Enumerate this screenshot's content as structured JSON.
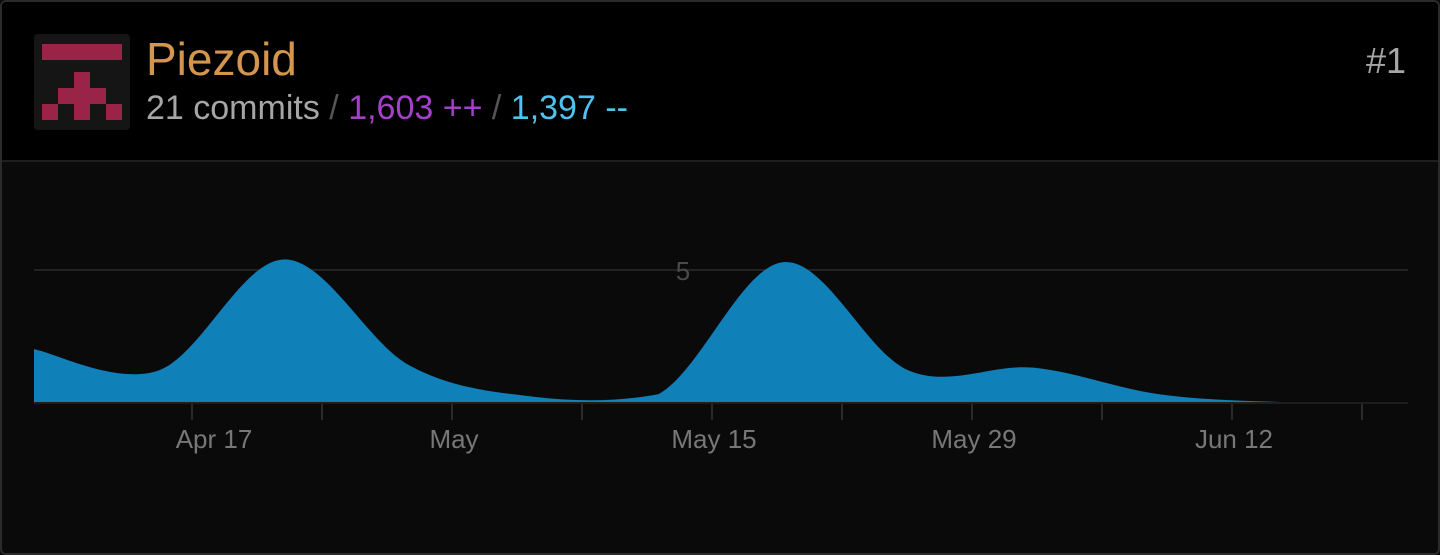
{
  "contributor": {
    "name": "Piezoid",
    "rank": "#1",
    "commits": "21 commits",
    "additions": "1,603 ++",
    "deletions": "1,397 --",
    "separator": "/",
    "avatar_icon": "pixel-identicon",
    "colors": {
      "name": "#d4954e",
      "additions": "#a541c9",
      "deletions": "#4ec3ee",
      "avatar": "#9a2448"
    }
  },
  "chart_data": {
    "type": "area",
    "title": "",
    "xlabel": "",
    "ylabel": "",
    "ylim": [
      0,
      5
    ],
    "yticks": [
      "5"
    ],
    "xticks": [
      "Apr 17",
      "May",
      "May 15",
      "May 29",
      "Jun 12"
    ],
    "grid": true,
    "color": "#0f80b8",
    "series": [
      {
        "x": [
          "Apr 5",
          "Apr 12",
          "Apr 19",
          "Apr 26",
          "May 3",
          "May 10",
          "May 17",
          "May 24",
          "May 31",
          "Jun 7",
          "Jun 14",
          "Jun 21"
        ],
        "values": [
          2.0,
          1.2,
          5.4,
          1.4,
          0.2,
          0.3,
          5.3,
          1.2,
          1.3,
          0.3,
          0.0,
          0.0
        ]
      }
    ]
  }
}
